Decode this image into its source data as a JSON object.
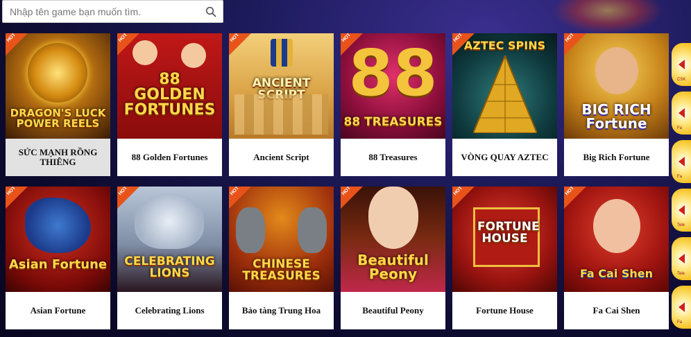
{
  "search": {
    "placeholder": "Nhập tên game bạn muốn tìm."
  },
  "games": [
    {
      "label": "SỨC MẠNH RỒNG THIÊNG",
      "art": "DRAGON'S LUCK POWER REELS",
      "hot": true
    },
    {
      "label": "88 Golden Fortunes",
      "art": "88 GOLDEN FORTUNES",
      "hot": true
    },
    {
      "label": "Ancient Script",
      "art": "ANCIENT SCRIPT",
      "hot": true
    },
    {
      "label": "88 Treasures",
      "art": "88 TREASURES",
      "hot": true
    },
    {
      "label": "VÒNG QUAY AZTEC",
      "art": "AZTEC SPINS",
      "hot": true
    },
    {
      "label": "Big Rich Fortune",
      "art": "BIG RICH Fortune",
      "hot": true
    },
    {
      "label": "Asian Fortune",
      "art": "Asian Fortune",
      "hot": true
    },
    {
      "label": "Celebrating Lions",
      "art": "CELEBRATING LIONS",
      "hot": true
    },
    {
      "label": "Bảo tàng Trung Hoa",
      "art": "CHINESE TREASURES",
      "hot": true
    },
    {
      "label": "Beautiful Peony",
      "art": "Beautiful Peony",
      "hot": true
    },
    {
      "label": "Fortune House",
      "art": "FORTUNE HOUSE",
      "hot": true
    },
    {
      "label": "Fa Cai Shen",
      "art": "Fa Cai Shen",
      "hot": true
    }
  ],
  "hot_badge": "HOT",
  "side_buttons": [
    {
      "text": "CSK"
    },
    {
      "text": "Fa"
    },
    {
      "text": "Fa"
    },
    {
      "text": "Tele"
    },
    {
      "text": "Tele"
    },
    {
      "text": "Fa"
    }
  ],
  "colors": {
    "hot": "#e8531a",
    "title_gold": "#ffd84a",
    "side_red": "#d0201a"
  }
}
